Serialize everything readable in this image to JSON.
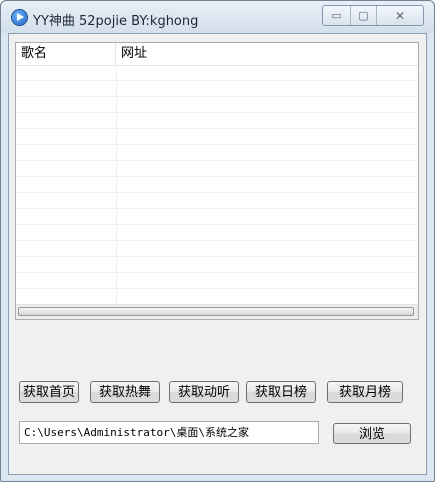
{
  "window": {
    "title": "YY神曲 52pojie BY:kghong",
    "controls": {
      "minimize": "▭",
      "maximize": "▢",
      "close": "✕"
    }
  },
  "list": {
    "columns": [
      "歌名",
      "网址"
    ],
    "rows": 15
  },
  "buttons": {
    "home": "获取首页",
    "hot_dance": "获取热舞",
    "moving": "获取动听",
    "daily": "获取日榜",
    "monthly": "获取月榜",
    "browse": "浏览"
  },
  "path": {
    "value": "C:\\Users\\Administrator\\桌面\\系统之家"
  },
  "colors": {
    "accent": "#1b5fc2",
    "frame": "#dce6f0"
  }
}
